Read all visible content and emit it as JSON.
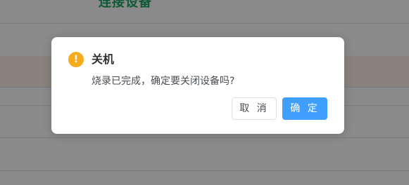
{
  "background": {
    "title": "连接设备"
  },
  "dialog": {
    "icon": "warning-icon",
    "icon_glyph": "!",
    "title": "关机",
    "message": "烧录已完成，确定要关闭设备吗?",
    "cancel_label": "取 消",
    "confirm_label": "确 定"
  },
  "colors": {
    "accent": "#409eff",
    "warning": "#f6ab1b",
    "brand_green": "#1fa564"
  }
}
